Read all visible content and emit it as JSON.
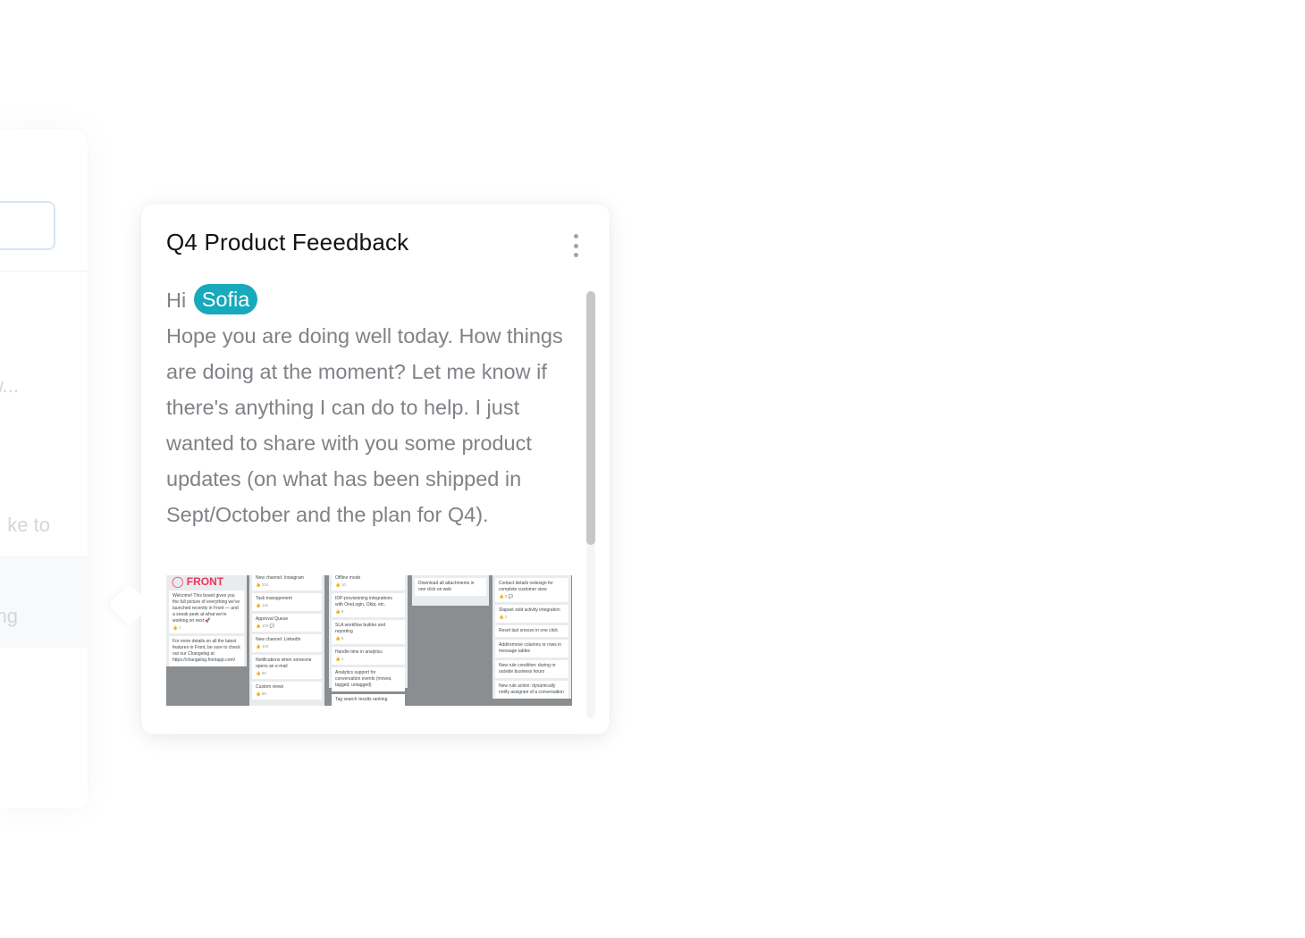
{
  "background_panel": {
    "fragment_1": "w...",
    "fragment_2": "ke to",
    "fragment_3": "ing"
  },
  "popover": {
    "title": "Q4 Product Feeedback",
    "greeting": "Hi",
    "mention": "Sofia",
    "message": "Hope you are doing well today. How things are doing at the moment? Let me know if there's anything I can do to help. I just wanted to share with you some product updates (on what has been shipped in Sept/October and the plan for Q4).",
    "more_icon": "more-vertical-icon",
    "mention_color": "#17a9bc"
  },
  "embedded_board": {
    "brand": "FRONT",
    "brand_color": "#e8385c",
    "columns": [
      {
        "cards": [
          {
            "text": "Welcome! This board gives you the full picture of everything we've launched recently in Front — and a sneak peek at what we're working on next 🚀",
            "meta": "👍 1"
          },
          {
            "text": "For more details on all the latest features in Front, be sure to check out our Changelog at https://changelog.frontapp.com/",
            "meta": ""
          }
        ]
      },
      {
        "cards": [
          {
            "text": "New channel: Instagram",
            "meta": "👍 224"
          },
          {
            "text": "Task management",
            "meta": "👍 115"
          },
          {
            "text": "Approval Queue",
            "meta": "👍 103  💬"
          },
          {
            "text": "New channel: LinkedIn",
            "meta": "👍 100"
          },
          {
            "text": "Notifications when someone opens an e-mail",
            "meta": "👍 90"
          },
          {
            "text": "Custom views",
            "meta": "👍 88"
          }
        ]
      },
      {
        "cards": [
          {
            "text": "Offline mode",
            "meta": "👍 10"
          },
          {
            "text": "IDP-provisioning integrations with OneLogin, Okta, etc.",
            "meta": "👍 9"
          },
          {
            "text": "SLA workflow builder and reporting",
            "meta": "👍 8"
          },
          {
            "text": "Handle time in analytics",
            "meta": "👍 1"
          },
          {
            "text": "Analytics support for conversation events (moves, tagged, untagged)",
            "meta": ""
          },
          {
            "text": "Tag search results ranking",
            "meta": ""
          }
        ]
      },
      {
        "cards": [
          {
            "text": "Download all attachments in one click on web",
            "meta": ""
          }
        ]
      },
      {
        "cards": [
          {
            "text": "Contact details redesign for complete customer view",
            "meta": "👍 3  💬"
          },
          {
            "text": "Slapset sold activity integration",
            "meta": "👍 2"
          },
          {
            "text": "Reset last snooze in one click",
            "meta": ""
          },
          {
            "text": "Add/remove columns or rows in message tables",
            "meta": ""
          },
          {
            "text": "New rule condition: during or outside business hours",
            "meta": ""
          },
          {
            "text": "New rule action: dynamically notify assignee of a conversation",
            "meta": ""
          }
        ]
      }
    ]
  }
}
